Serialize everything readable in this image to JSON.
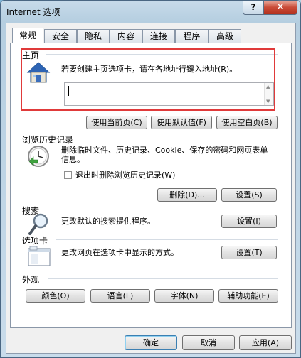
{
  "window": {
    "title": "Internet 选项",
    "help": "?",
    "close": "✕"
  },
  "tabs": [
    "常规",
    "安全",
    "隐私",
    "内容",
    "连接",
    "程序",
    "高级"
  ],
  "homepage": {
    "section": "主页",
    "instruction": "若要创建主页选项卡，请在各地址行键入地址(R)。",
    "value": "",
    "buttons": {
      "current": "使用当前页(C)",
      "default": "使用默认值(F)",
      "blank": "使用空白页(B)"
    }
  },
  "history": {
    "section": "浏览历史记录",
    "desc": "删除临时文件、历史记录、Cookie、保存的密码和网页表单信息。",
    "checkbox": "退出时删除浏览历史记录(W)",
    "checked": false,
    "delete": "删除(D)...",
    "settings": "设置(S)"
  },
  "search": {
    "section": "搜索",
    "desc": "更改默认的搜索提供程序。",
    "settings": "设置(I)"
  },
  "tabsSection": {
    "section": "选项卡",
    "desc": "更改网页在选项卡中显示的方式。",
    "settings": "设置(T)"
  },
  "appearance": {
    "section": "外观",
    "colors": "颜色(O)",
    "languages": "语言(L)",
    "fonts": "字体(N)",
    "accessibility": "辅助功能(E)"
  },
  "footer": {
    "ok": "确定",
    "cancel": "取消",
    "apply": "应用(A)"
  },
  "colors": {
    "highlight": "#e03a3a"
  }
}
